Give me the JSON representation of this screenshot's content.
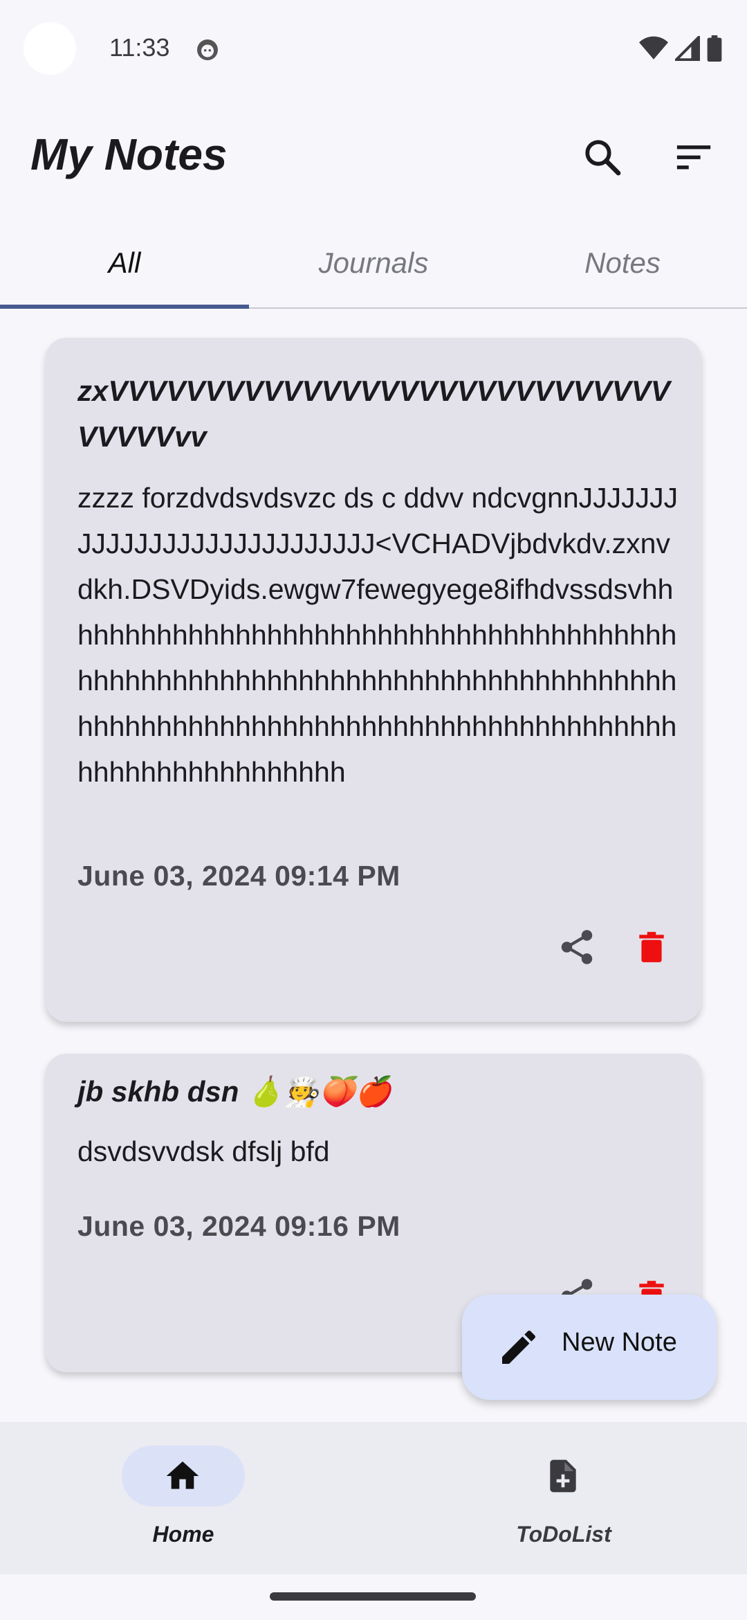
{
  "status_bar": {
    "time": "11:33",
    "icons": [
      "face-icon",
      "wifi-icon",
      "signal-icon",
      "battery-icon"
    ]
  },
  "app_bar": {
    "title": "My Notes",
    "actions": [
      "search-icon",
      "sort-icon"
    ]
  },
  "tabs": [
    {
      "label": "All",
      "active": true
    },
    {
      "label": "Journals",
      "active": false
    },
    {
      "label": "Notes",
      "active": false
    }
  ],
  "notes": [
    {
      "title": "zxVVVVVVVVVVVVVVVVVVVVVVVVVVVVVVVVVVvv",
      "body": "zzzz forzdvdsvdsvzc ds c ddvv ndcvgnnJJJJJJJJJJJJJJJJJJJJJJJJJJJJ<VCHADVjbdvkdv.zxnvdkh.DSVDyids.ewgw7fewegyege8ifhdvssdsvhhhhhhhhhhhhhhhhhhhhhhhhhhhhhhhhhhhhhhhhhhhhhhhhhhhhhhhhhhhhhhhhhhhhhhhhhhhhhhhhhhhhhhhhhhhhhhhhhhhhhhhhhhhhhhhhhhhhhhhhhhhhhhhhhhhhh",
      "date": "June 03, 2024 09:14 PM"
    },
    {
      "title": "jb skhb dsn  🍐🧑‍🍳🍑🍎",
      "body": "dsvdsvvdsk dfslj bfd",
      "date": "June 03, 2024 09:16 PM"
    }
  ],
  "fab": {
    "label": "New Note",
    "icon": "pencil-icon"
  },
  "bottom_nav": [
    {
      "label": "Home",
      "icon": "home-icon",
      "active": true
    },
    {
      "label": "ToDoList",
      "icon": "note-add-icon",
      "active": false
    }
  ],
  "colors": {
    "tab_indicator": "#475b8f",
    "delete": "#ee1010",
    "card_bg": "#e3e2ea",
    "fab_bg": "#d9e2fa"
  }
}
